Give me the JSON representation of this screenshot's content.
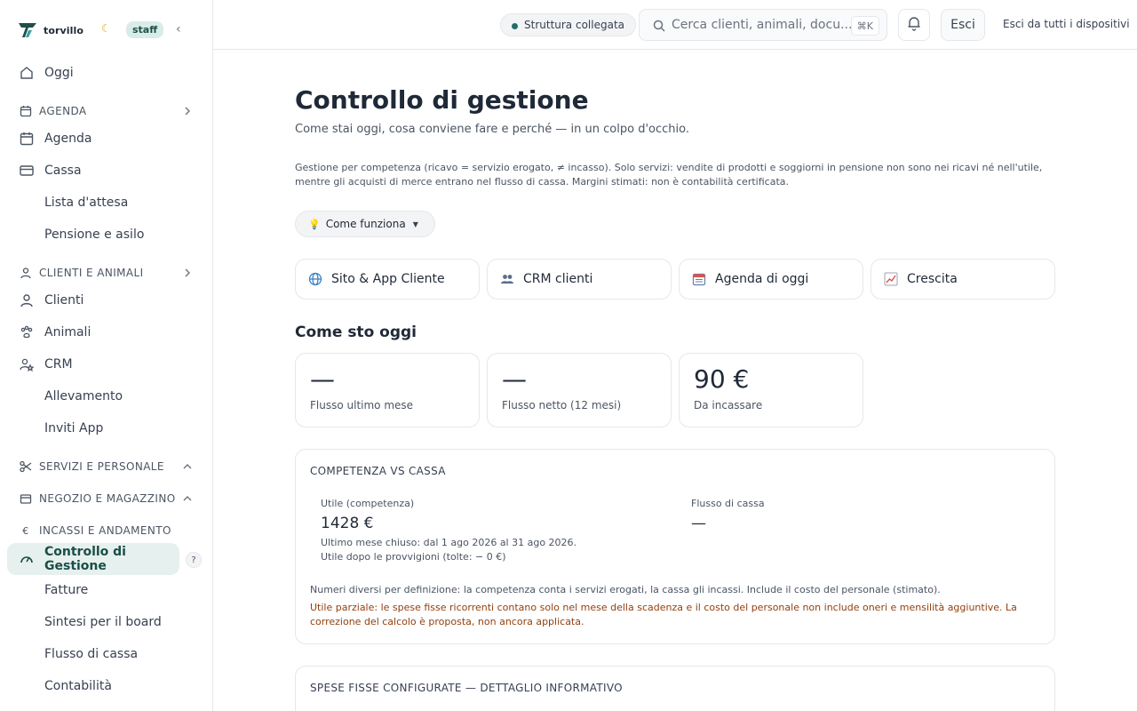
{
  "brand": {
    "name": "torvillo",
    "role_badge": "staff"
  },
  "sidebar": {
    "today": "Oggi",
    "sections": {
      "agenda": "AGENDA",
      "clients": "CLIENTI E ANIMALI",
      "services": "SERVIZI E PERSONALE",
      "shop": "NEGOZIO E MAGAZZINO",
      "income": "INCASSI E ANDAMENTO"
    },
    "items": {
      "agenda": "Agenda",
      "cassa": "Cassa",
      "waitlist": "Lista d'attesa",
      "boarding": "Pensione e asilo",
      "clients": "Clienti",
      "animals": "Animali",
      "crm": "CRM",
      "breeding": "Allevamento",
      "invites": "Inviti App",
      "control": "Controllo di Gestione",
      "invoices": "Fatture",
      "board": "Sintesi per il board",
      "cashflow": "Flusso di cassa",
      "accounting": "Contabilità"
    },
    "help": "?"
  },
  "topbar": {
    "status": "Struttura collegata",
    "search_placeholder": "Cerca clienti, animali, docu...",
    "search_shortcut": "⌘K",
    "logout": "Esci",
    "logout_all": "Esci da tutti i dispositivi"
  },
  "page": {
    "title": "Controllo di gestione",
    "subtitle": "Come stai oggi, cosa conviene fare e perché — in un colpo d'occhio.",
    "disclaimer": "Gestione per competenza (ricavo = servizio erogato, ≠ incasso). Solo servizi: vendite di prodotti e soggiorni in pensione non sono nei ricavi né nell'utile, mentre gli acquisti di merce entrano nel flusso di cassa. Margini stimati: non è contabilità certificata.",
    "how_button": "Come funziona",
    "quick_links": [
      {
        "label": "Sito & App Cliente",
        "icon": "globe-icon"
      },
      {
        "label": "CRM clienti",
        "icon": "people-icon"
      },
      {
        "label": "Agenda di oggi",
        "icon": "calendar-icon"
      },
      {
        "label": "Crescita",
        "icon": "chart-up-icon"
      }
    ],
    "section_today": "Come sto oggi",
    "kpis": [
      {
        "value": "—",
        "label": "Flusso ultimo mese"
      },
      {
        "value": "—",
        "label": "Flusso netto (12 mesi)"
      },
      {
        "value": "90 €",
        "label": "Da incassare"
      }
    ],
    "competence_card": {
      "title": "COMPETENZA VS CASSA",
      "left_label": "Utile (competenza)",
      "left_value": "1428 €",
      "left_note_1": "Ultimo mese chiuso: dal 1 ago 2026 al 31 ago 2026.",
      "left_note_2": "Utile dopo le provvigioni (tolte: − 0 €)",
      "right_label": "Flusso di cassa",
      "right_value": "—",
      "description": "Numeri diversi per definizione: la competenza conta i servizi erogati, la cassa gli incassi. Include il costo del personale (stimato).",
      "warning": "Utile parziale: le spese fisse ricorrenti contano solo nel mese della scadenza e il costo del personale non include oneri e mensilità aggiuntive. La correzione del calcolo è proposta, non ancora applicata."
    },
    "fixed_costs_card": {
      "title": "SPESE FISSE CONFIGURATE — DETTAGLIO INFORMATIVO"
    }
  },
  "colors": {
    "accent": "#1a4e48",
    "accent_bg": "#e6f0ee",
    "warning": "#92400e"
  }
}
